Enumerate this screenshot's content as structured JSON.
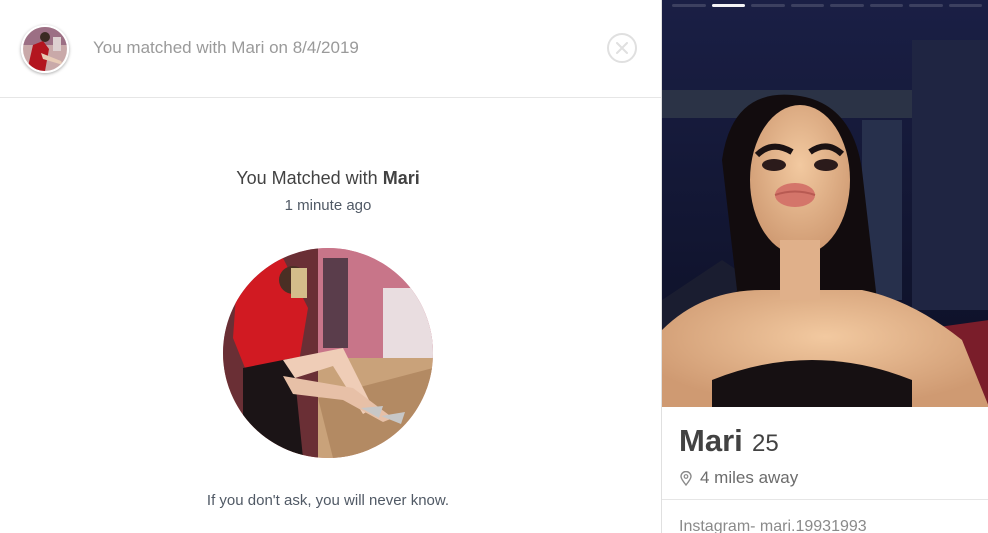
{
  "header": {
    "match_text": "You matched with Mari on 8/4/2019"
  },
  "match": {
    "title_prefix": "You Matched with ",
    "title_name": "Mari",
    "time_ago": "1 minute ago",
    "bio": "If you don't ask, you will never know."
  },
  "profile": {
    "name": "Mari",
    "age": "25",
    "distance": "4 miles away",
    "bio": "Instagram- mari.19931993",
    "photo_count": 8,
    "active_photo_index": 1
  },
  "icons": {
    "close": "close-icon",
    "location": "location-pin-icon"
  },
  "colors": {
    "text_dark": "#424242",
    "text_muted": "#9a9a9a",
    "divider": "#e6e6e6"
  }
}
